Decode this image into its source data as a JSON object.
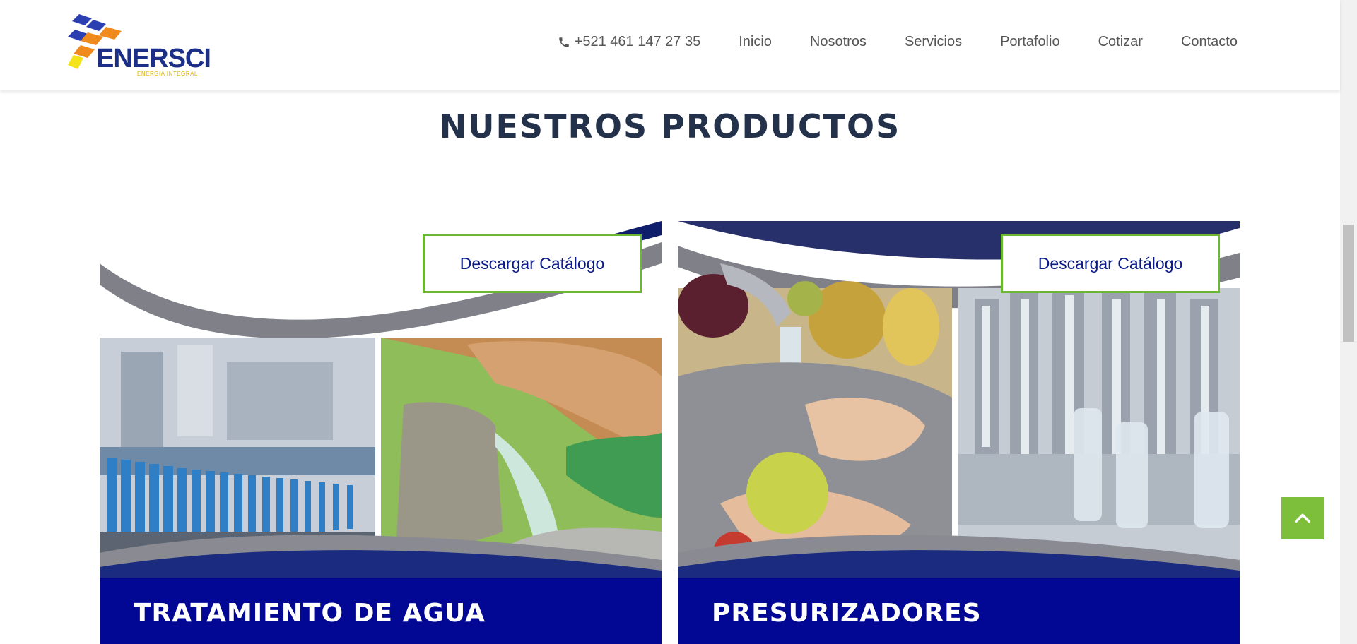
{
  "brand": {
    "name": "ENERSCI",
    "tagline": "ENERGIA INTEGRAL",
    "colors": {
      "blue": "#1c2f88",
      "orange": "#f08a1d",
      "yellow": "#f4e21a"
    }
  },
  "nav": {
    "phone_icon": "phone-icon",
    "phone": "+521 461 147 27 35",
    "items": [
      "Inicio",
      "Nosotros",
      "Servicios",
      "Portafolio",
      "Cotizar",
      "Contacto"
    ]
  },
  "section": {
    "title": "NUESTROS PRODUCTOS"
  },
  "products": [
    {
      "title": "TRATAMIENTO DE AGUA",
      "button": "Descargar Catálogo"
    },
    {
      "title": "PRESURIZADORES",
      "button": "Descargar Catálogo"
    }
  ],
  "back_to_top": {
    "icon": "chevron-up-icon"
  },
  "colors": {
    "heading": "#24314a",
    "footer_band": "#020794",
    "button_border": "#6cb731",
    "back_to_top": "#7dbf3a"
  }
}
